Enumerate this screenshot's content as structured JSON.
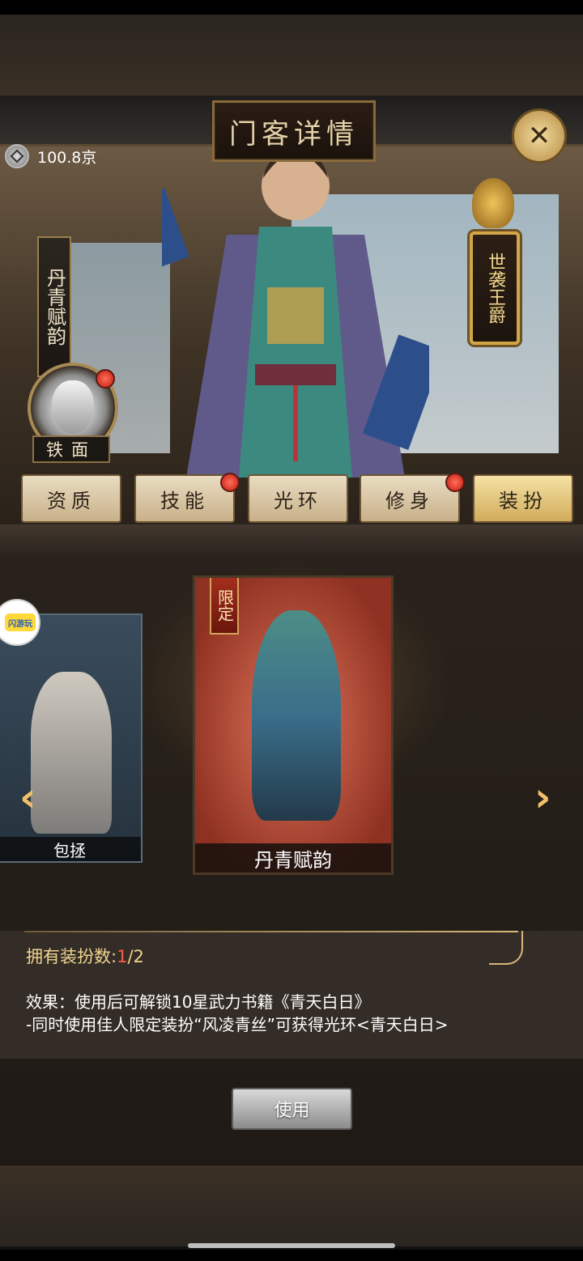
{
  "header": {
    "title": "门客详情",
    "currency_value": "100.8京",
    "close_label": "✕"
  },
  "hero": {
    "costume_name_vertical": "丹青赋韵",
    "mask_label": "铁面",
    "rank_badge": "世袭王爵"
  },
  "tabs": [
    {
      "label": "资质",
      "dot": false
    },
    {
      "label": "技能",
      "dot": true
    },
    {
      "label": "光环",
      "dot": false
    },
    {
      "label": "修身",
      "dot": true
    },
    {
      "label": "装扮",
      "dot": false,
      "active": true
    }
  ],
  "cards": {
    "left_name": "包拯",
    "center_name": "丹青赋韵",
    "center_tag": "限定",
    "side_badge": "闪游玩",
    "arrow_left": "‹",
    "arrow_right": "›"
  },
  "info": {
    "owned_label": "拥有装扮数:",
    "owned_count": "1",
    "owned_total": "/2",
    "effect_line1": "效果：使用后可解锁10星武力书籍《青天白日》",
    "effect_line2": "-同时使用佳人限定装扮“风凌青丝”可获得光环<青天白日>"
  },
  "actions": {
    "use_label": "使用"
  },
  "colors": {
    "gold": "#f0d490",
    "red_dot": "#c31b10",
    "panel": "#2a231c"
  }
}
